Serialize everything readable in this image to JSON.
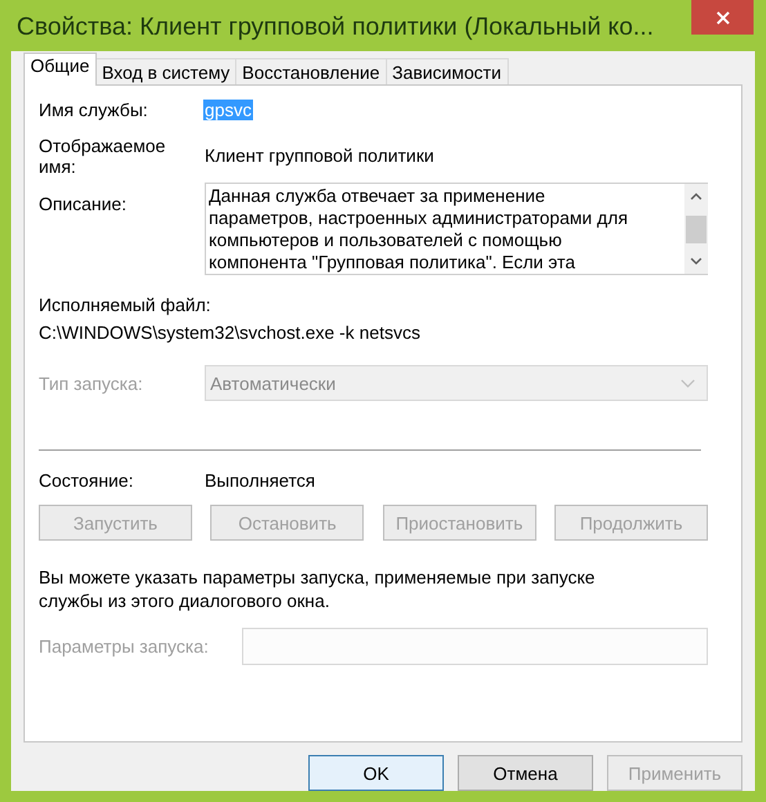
{
  "window": {
    "title": "Свойства: Клиент групповой политики (Локальный ко..."
  },
  "tabs": [
    {
      "label": "Общие",
      "selected": true
    },
    {
      "label": "Вход в систему",
      "selected": false
    },
    {
      "label": "Восстановление",
      "selected": false
    },
    {
      "label": "Зависимости",
      "selected": false
    }
  ],
  "service_name": {
    "label": "Имя службы:",
    "value": "gpsvc",
    "highlighted": true
  },
  "display_name": {
    "label": "Отображаемое имя:",
    "value": "Клиент групповой политики"
  },
  "description": {
    "label": "Описание:",
    "lines": [
      "Данная служба отвечает за применение",
      "параметров, настроенных администраторами для",
      "компьютеров и пользователей с помощью",
      "компонента \"Групповая политика\". Если эта"
    ]
  },
  "executable": {
    "label": "Исполняемый файл:",
    "value": "C:\\WINDOWS\\system32\\svchost.exe -k netsvcs"
  },
  "startup_type": {
    "label": "Тип запуска:",
    "value": "Автоматически",
    "disabled": true
  },
  "status": {
    "label": "Состояние:",
    "value": "Выполняется"
  },
  "service_buttons": [
    {
      "label": "Запустить",
      "disabled": true
    },
    {
      "label": "Остановить",
      "disabled": true
    },
    {
      "label": "Приостановить",
      "disabled": true
    },
    {
      "label": "Продолжить",
      "disabled": true
    }
  ],
  "hint": "Вы можете указать параметры запуска, применяемые при запуске службы из этого диалогового окна.",
  "start_parameters": {
    "label": "Параметры запуска:",
    "disabled": true
  },
  "dialog_buttons": [
    {
      "label": "OK",
      "default": true,
      "disabled": false
    },
    {
      "label": "Отмена",
      "default": false,
      "disabled": false
    },
    {
      "label": "Применить",
      "default": false,
      "disabled": true
    }
  ]
}
